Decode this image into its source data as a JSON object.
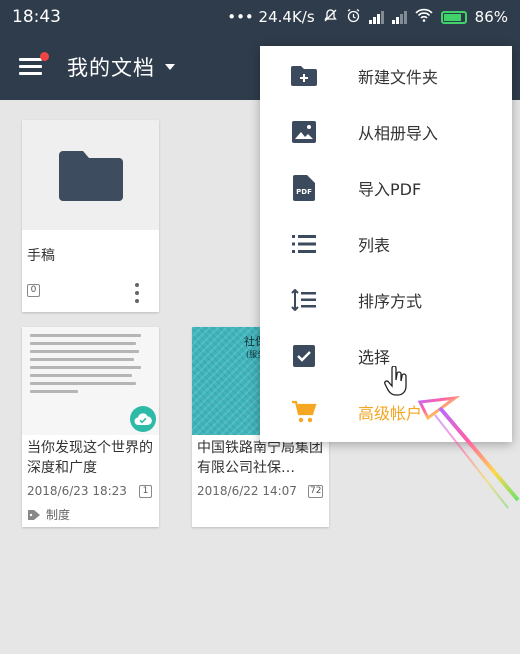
{
  "status_bar": {
    "time": "18:43",
    "network_speed": "••• 24.4K/s",
    "battery": "86%",
    "icons": [
      "mute-icon",
      "alarm-icon",
      "signal-icon",
      "signal-icon",
      "wifi-icon",
      "battery-icon"
    ]
  },
  "app_bar": {
    "title": "我的文档",
    "menu_icon": "hamburger-icon",
    "dropdown_icon": "caret-down-icon"
  },
  "documents": [
    {
      "type": "folder",
      "title": "手稿",
      "count": "0"
    },
    {
      "type": "document",
      "title": "当你发现这个世界的深度和广度",
      "date": "2018/6/23 18:23",
      "count": "1",
      "tag": "制度",
      "synced": true
    },
    {
      "type": "document",
      "title": "中国铁路南宁局集团有限公司社保…",
      "date": "2018/6/22 14:07",
      "count": "72",
      "thumbnail_text": "社保办",
      "thumbnail_subtext": "(服务)"
    }
  ],
  "popup_menu": {
    "items": [
      {
        "label": "新建文件夹",
        "icon": "new-folder-icon"
      },
      {
        "label": "从相册导入",
        "icon": "image-icon"
      },
      {
        "label": "导入PDF",
        "icon": "pdf-icon"
      },
      {
        "label": "列表",
        "icon": "list-icon"
      },
      {
        "label": "排序方式",
        "icon": "sort-icon"
      },
      {
        "label": "选择",
        "icon": "checkbox-icon"
      },
      {
        "label": "高级帐户",
        "icon": "cart-icon",
        "accent": true
      }
    ]
  },
  "colors": {
    "primary": "#2f3c4b",
    "accent": "#f5a623",
    "icon": "#3b4a5c",
    "sync": "#2dbba7"
  }
}
